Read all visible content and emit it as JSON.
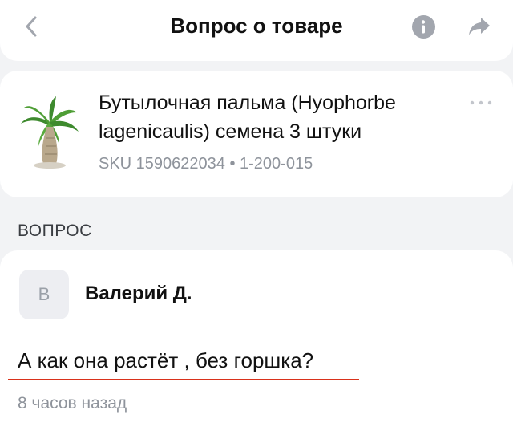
{
  "header": {
    "title": "Вопрос о товаре",
    "back_icon": "chevron-left-icon",
    "info_icon": "info-icon",
    "share_icon": "share-icon"
  },
  "product": {
    "title": "Бутылочная пальма (Hyophorbe lagenicaulis) семена 3 штуки",
    "meta": "SKU 1590622034 • 1-200-015",
    "image_icon": "palm-tree-image",
    "more_icon": "more-dots-icon"
  },
  "section": {
    "label": "ВОПРОС"
  },
  "question": {
    "avatar_letter": "В",
    "author": "Валерий Д.",
    "text": "А как она растёт , без горшка?",
    "timestamp": "8 часов назад"
  },
  "colors": {
    "background": "#f2f3f5",
    "card": "#ffffff",
    "text_primary": "#111111",
    "text_secondary": "#8e939b",
    "icon_gray": "#a2a6ae",
    "annotation_red": "#d9321c"
  }
}
